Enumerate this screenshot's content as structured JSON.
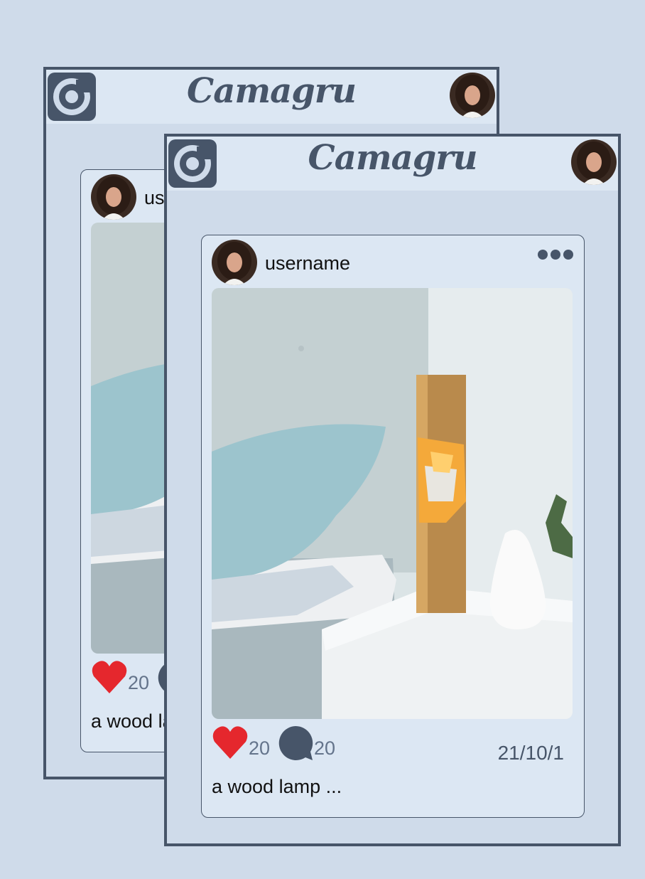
{
  "app": {
    "brand": "Camagru"
  },
  "icons": {
    "logo": "camera-lens-icon",
    "profile": "user-avatar",
    "more": "more-dots-icon",
    "like": "heart-icon",
    "comment": "comment-bubble-icon"
  },
  "colors": {
    "background": "#cfdbea",
    "panel": "#dce7f3",
    "accent": "#475569",
    "heart": "#e5272d"
  },
  "post": {
    "username": "username",
    "likes": "20",
    "comments": "20",
    "date": "21/10/1",
    "caption": "a wood lamp ..."
  }
}
